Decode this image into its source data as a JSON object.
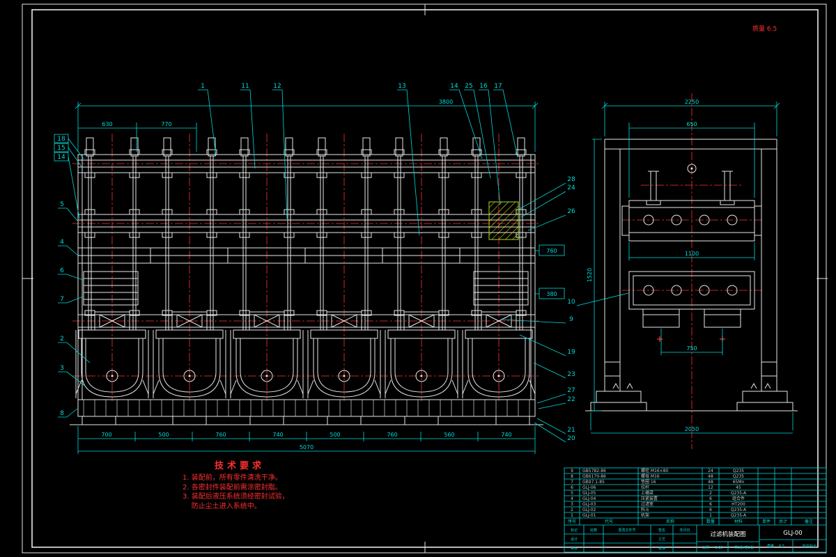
{
  "sheet": {
    "background": "#000000",
    "line_color": "#e8e8e8",
    "dim_color": "#00dcdc",
    "center_color": "#ff3333",
    "hatch_color": "#ffff00"
  },
  "stamp": {
    "note": "质量 6.5"
  },
  "callouts": {
    "top": [
      "1",
      "11",
      "12",
      "13",
      "14",
      "25",
      "16",
      "17"
    ],
    "left_boxed": [
      "18",
      "15",
      "14"
    ],
    "left": [
      "5",
      "4",
      "6",
      "7",
      "2",
      "3",
      "8"
    ],
    "right": [
      "28",
      "24",
      "26",
      "10",
      "9",
      "19",
      "23",
      "27",
      "22",
      "21",
      "20"
    ]
  },
  "dims": {
    "main": {
      "total_top": "3800",
      "left_a": "630",
      "left_b": "770",
      "right_a": "760",
      "right_b": "380",
      "bottom": [
        "700",
        "500",
        "760",
        "740",
        "500",
        "760",
        "560",
        "740"
      ],
      "bottom_total": "5070"
    },
    "side": {
      "top": "2250",
      "inner": "650",
      "height": "1520",
      "mid": "1100",
      "feet": "750",
      "bottom": "2050"
    }
  },
  "tech": {
    "title": "技术要求",
    "lines": [
      "1. 装配前，所有零件清洗干净。",
      "2. 各密封件装配前需涂密封脂。",
      "3. 装配后液压系统须经密封试验，",
      "    防止尘土进入系统中。"
    ]
  },
  "bom": {
    "headers": {
      "seq": "序号",
      "code": "代号",
      "name": "名称",
      "qty": "数量",
      "material": "材料",
      "unit": "单件",
      "total": "总计",
      "note": "备注"
    },
    "rows": [
      {
        "seq": "9",
        "code": "GB5782-86",
        "name": "螺栓 M16×80",
        "qty": "24",
        "material": "Q235",
        "note": ""
      },
      {
        "seq": "8",
        "code": "GB6170-86",
        "name": "螺母 M16",
        "qty": "48",
        "material": "Q235",
        "note": ""
      },
      {
        "seq": "7",
        "code": "GB97.1-85",
        "name": "垫圈 16",
        "qty": "48",
        "material": "65Mn",
        "note": ""
      },
      {
        "seq": "6",
        "code": "GLJ-06",
        "name": "拉杆",
        "qty": "12",
        "material": "45",
        "note": ""
      },
      {
        "seq": "5",
        "code": "GLJ-05",
        "name": "上横梁",
        "qty": "2",
        "material": "Q235-A",
        "note": ""
      },
      {
        "seq": "4",
        "code": "GLJ-04",
        "name": "压紧装置",
        "qty": "6",
        "material": "组合件",
        "note": ""
      },
      {
        "seq": "3",
        "code": "GLJ-03",
        "name": "过滤室",
        "qty": "6",
        "material": "HT200",
        "note": ""
      },
      {
        "seq": "2",
        "code": "GLJ-02",
        "name": "料斗",
        "qty": "6",
        "material": "Q235-A",
        "note": ""
      },
      {
        "seq": "1",
        "code": "GLJ-01",
        "name": "机架",
        "qty": "1",
        "material": "Q235-A",
        "note": ""
      }
    ]
  },
  "titleblock": {
    "name": "过滤机装配图",
    "drawing_no": "GLJ-00",
    "scale_label": "比例",
    "scale": "1:10",
    "sheet_label": "共1张 第1张",
    "mass_label": "质量",
    "mass": "6.5",
    "stage_label": "阶段标记",
    "row1": [
      "标记",
      "处数",
      "更改文件号",
      "签名",
      "年月日"
    ],
    "design": "设计",
    "check": "审核",
    "process": "工艺",
    "approve": "批准"
  }
}
